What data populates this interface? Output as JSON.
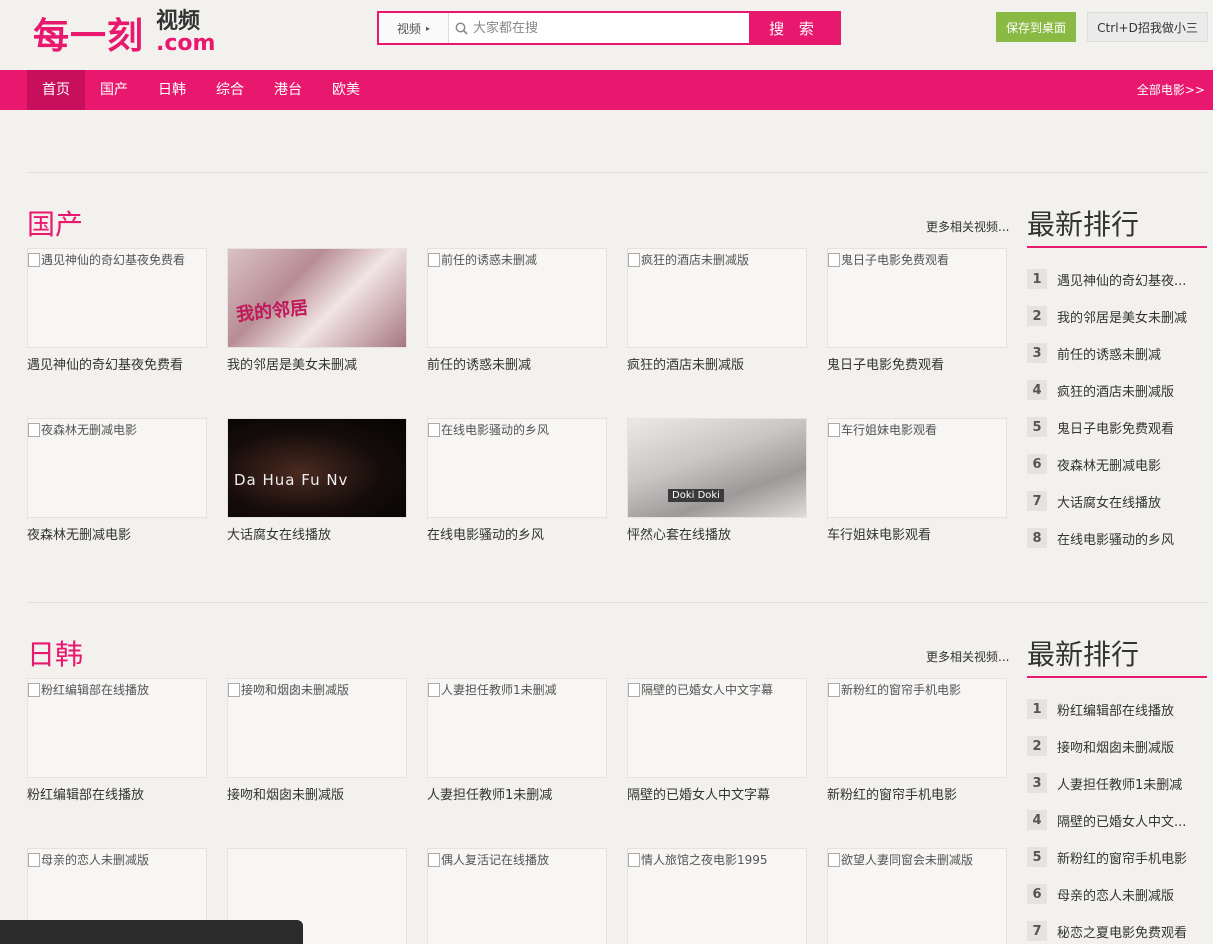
{
  "header": {
    "logo_main": "每一刻",
    "logo_side_top": "视频",
    "logo_side_bottom": ".com",
    "search_category": "视频",
    "search_placeholder": "大家都在搜",
    "search_button": "搜 索",
    "save_desktop": "保存到桌面",
    "bookmark": "Ctrl+D招我做小三"
  },
  "nav": {
    "items": [
      "首页",
      "国产",
      "日韩",
      "综合",
      "港台",
      "欧美"
    ],
    "all_movies": "全部电影>>"
  },
  "sections": [
    {
      "title": "国产",
      "more": "更多相关视频...",
      "cards": [
        {
          "alt": "遇见神仙的奇幻基夜免费看",
          "title": "遇见神仙的奇幻基夜免费看",
          "poster": ""
        },
        {
          "alt": "",
          "title": "我的邻居是美女未删减",
          "poster": "我的邻居"
        },
        {
          "alt": "前任的诱惑未删减",
          "title": "前任的诱惑未删减",
          "poster": ""
        },
        {
          "alt": "疯狂的酒店未删减版",
          "title": "疯狂的酒店未删减版",
          "poster": ""
        },
        {
          "alt": "鬼日子电影免费观看",
          "title": "鬼日子电影免费观看",
          "poster": ""
        },
        {
          "alt": "夜森林无删减电影",
          "title": "夜森林无删减电影",
          "poster": ""
        },
        {
          "alt": "",
          "title": "大话腐女在线播放",
          "poster": "Da Hua Fu Nv"
        },
        {
          "alt": "在线电影骚动的乡风",
          "title": "在线电影骚动的乡风",
          "poster": ""
        },
        {
          "alt": "",
          "title": "怦然心套在线播放",
          "poster": "Doki Doki"
        },
        {
          "alt": "车行姐妹电影观看",
          "title": "车行姐妹电影观看",
          "poster": ""
        }
      ]
    },
    {
      "title": "日韩",
      "more": "更多相关视频...",
      "cards": [
        {
          "alt": "粉红编辑部在线播放",
          "title": "粉红编辑部在线播放",
          "poster": ""
        },
        {
          "alt": "接吻和烟囱未删减版",
          "title": "接吻和烟囱未删减版",
          "poster": ""
        },
        {
          "alt": "人妻担任教师1未删减",
          "title": "人妻担任教师1未删减",
          "poster": ""
        },
        {
          "alt": "隔壁的已婚女人中文字幕",
          "title": "隔壁的已婚女人中文字幕",
          "poster": ""
        },
        {
          "alt": "新粉红的窗帘手机电影",
          "title": "新粉红的窗帘手机电影",
          "poster": ""
        },
        {
          "alt": "母亲的恋人未删减版",
          "title": "",
          "poster": ""
        },
        {
          "alt": "",
          "title": "",
          "poster": ""
        },
        {
          "alt": "偶人复活记在线播放",
          "title": "",
          "poster": ""
        },
        {
          "alt": "情人旅馆之夜电影1995",
          "title": "",
          "poster": ""
        },
        {
          "alt": "欲望人妻同窗会未删减版",
          "title": "",
          "poster": ""
        }
      ]
    }
  ],
  "rankings": [
    {
      "title": "最新排行",
      "items": [
        "遇见神仙的奇幻基夜...",
        "我的邻居是美女未删减",
        "前任的诱惑未删减",
        "疯狂的酒店未删减版",
        "鬼日子电影免费观看",
        "夜森林无删减电影",
        "大话腐女在线播放",
        "在线电影骚动的乡风"
      ]
    },
    {
      "title": "最新排行",
      "items": [
        "粉红编辑部在线播放",
        "接吻和烟囱未删减版",
        "人妻担任教师1未删减",
        "隔壁的已婚女人中文...",
        "新粉红的窗帘手机电影",
        "母亲的恋人未删减版",
        "秘恋之夏电影免费观看"
      ]
    }
  ],
  "colors": {
    "brand": "#e8186e",
    "save_green": "#8ab944"
  },
  "icons": {
    "search": "magnifier-icon",
    "dropdown": "caret-right-icon"
  }
}
